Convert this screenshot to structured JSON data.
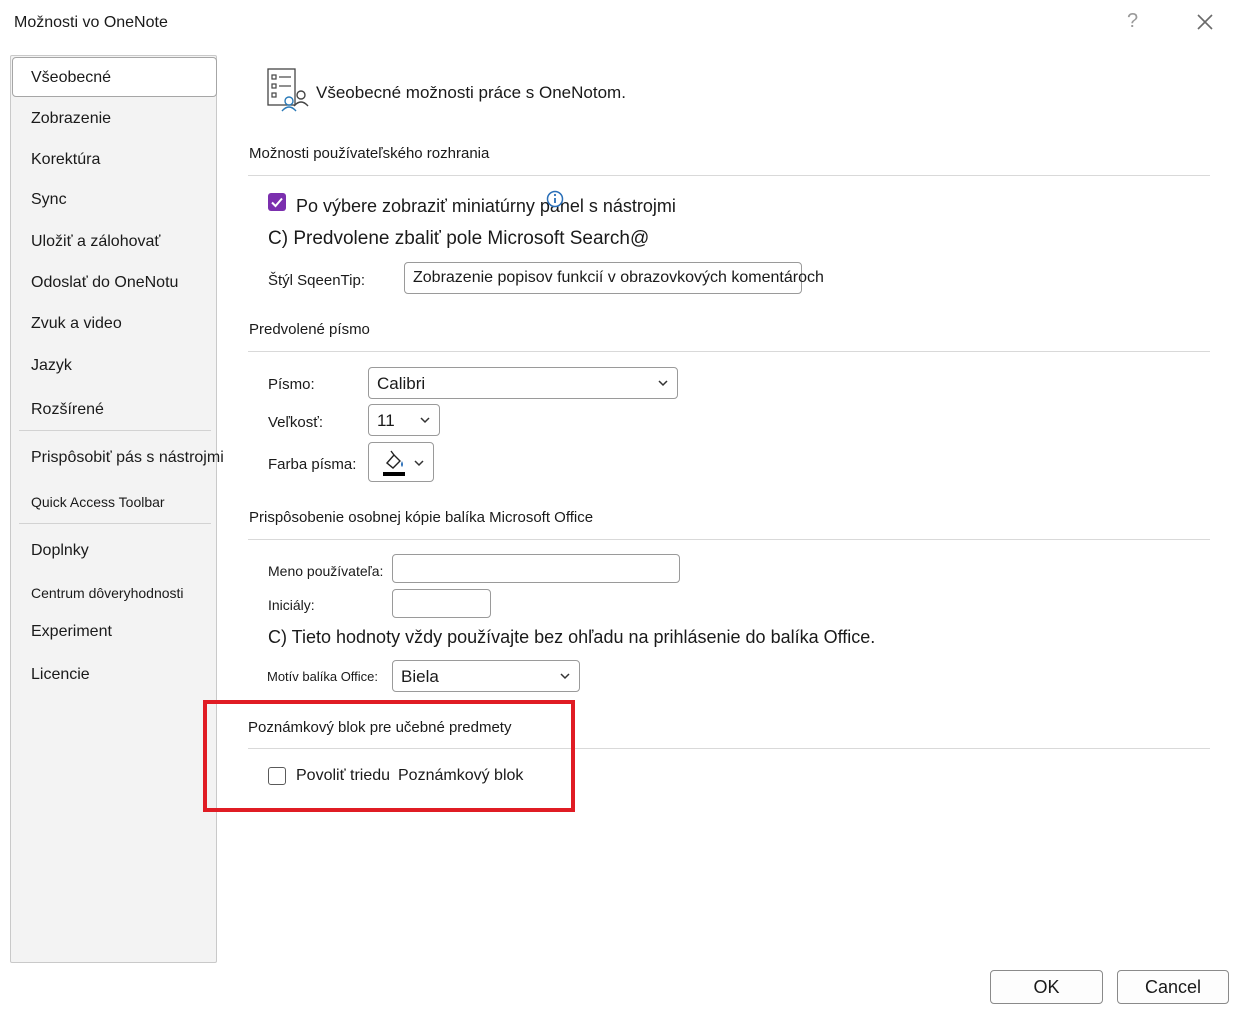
{
  "window": {
    "title": "Možnosti vo OneNote",
    "help_glyph": "?",
    "close_icon": "close-icon"
  },
  "sidebar": {
    "items": [
      {
        "label": "Všeobecné",
        "selected": true
      },
      {
        "label": "Zobrazenie"
      },
      {
        "label": "Korektúra"
      },
      {
        "label": "Sync"
      },
      {
        "label": "Uložiť a zálohovať"
      },
      {
        "label": "Odoslať do OneNotu"
      },
      {
        "label": "Zvuk a video"
      },
      {
        "label": "Jazyk"
      },
      {
        "label": "Rozšírené"
      },
      {
        "label": "Prispôsobiť pás s nástrojmi"
      },
      {
        "label": "Quick Access Toolbar"
      },
      {
        "label": "Doplnky"
      },
      {
        "label": "Centrum dôveryhodnosti"
      },
      {
        "label": "Experiment"
      },
      {
        "label": "Licencie"
      }
    ]
  },
  "main": {
    "header": "Všeobecné možnosti práce s OneNotom.",
    "ui_options": {
      "title": "Možnosti používateľského rozhrania",
      "mini_toolbar": {
        "label": "Po výbere zobraziť miniatúrny panel s nástrojmi",
        "checked": true
      },
      "collapse_search": "C) Predvolene zbaliť pole Microsoft Search@",
      "screentip_label": "Štýl SqeenTip:",
      "screentip_value": "Zobrazenie popisov funkcií v obrazovkových komentároch"
    },
    "default_font": {
      "title": "Predvolené písmo",
      "font_label": "Písmo:",
      "font_value": "Calibri",
      "size_label": "Veľkosť:",
      "size_value": "11",
      "color_label": "Farba písma:"
    },
    "personalize": {
      "title": "Prispôsobenie osobnej kópie balíka Microsoft Office",
      "username_label": "Meno používateľa:",
      "username_value": "",
      "initials_label": "Iniciály:",
      "initials_value": "",
      "always_use": "C) Tieto hodnoty vždy používajte bez ohľadu na prihlásenie do balíka Office.",
      "theme_label": "Motív balíka Office:",
      "theme_value": "Biela"
    },
    "class_notebook": {
      "title": "Poznámkový blok pre učebné predmety",
      "enable_label": "Povoliť triedu",
      "enable_label2": "Poznámkový blok",
      "checked": false
    }
  },
  "footer": {
    "ok_label": "OK",
    "cancel_label": "Cancel"
  },
  "colors": {
    "accent": "#7b2fae",
    "highlight_border": "#e01c24"
  }
}
